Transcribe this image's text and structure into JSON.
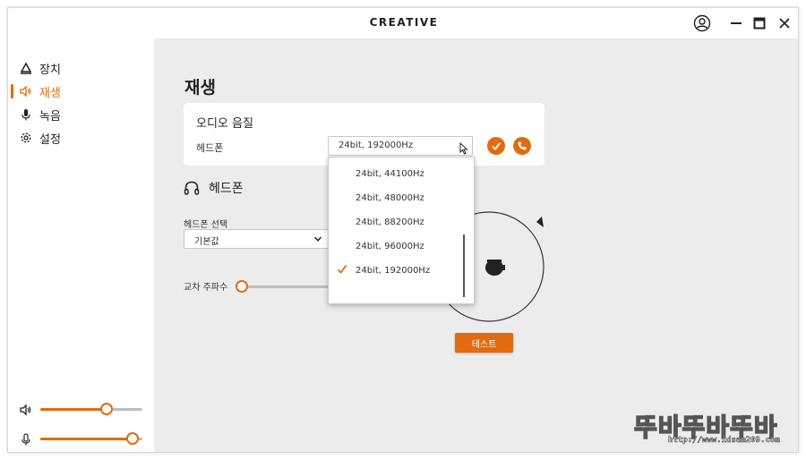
{
  "app": {
    "brand": "CREATIVE"
  },
  "titlebar": {
    "user_icon": "user-circle-icon",
    "minimize_icon": "minimize-icon",
    "maximize_icon": "maximize-icon",
    "close_icon": "close-icon"
  },
  "sidebar": {
    "items": [
      {
        "label": "장치",
        "icon": "device-icon"
      },
      {
        "label": "재생",
        "icon": "speaker-icon",
        "active": true
      },
      {
        "label": "녹음",
        "icon": "microphone-icon"
      },
      {
        "label": "설정",
        "icon": "gear-icon"
      }
    ],
    "speaker_volume": 0.65,
    "mic_volume": 0.9
  },
  "main": {
    "title": "재생",
    "audio_quality": {
      "title": "오디오 음질",
      "label": "헤드폰",
      "selected": "24bit, 192000Hz",
      "options": [
        "24bit, 44100Hz",
        "24bit, 48000Hz",
        "24bit, 88200Hz",
        "24bit, 96000Hz",
        "24bit, 192000Hz"
      ],
      "checked_option": 4
    },
    "headphone": {
      "title": "헤드폰",
      "select_label": "헤드폰 선택",
      "select_value": "기본값"
    },
    "crossfeed_label": "교차 주파수",
    "crossfeed_value": 0.0,
    "test_button": "테스트"
  },
  "watermark": {
    "text": "뚜바뚜바뚜바",
    "url": "http://www.idsam209.com"
  },
  "colors": {
    "accent": "#e26b10",
    "background": "#ececec",
    "panel": "#ffffff"
  }
}
